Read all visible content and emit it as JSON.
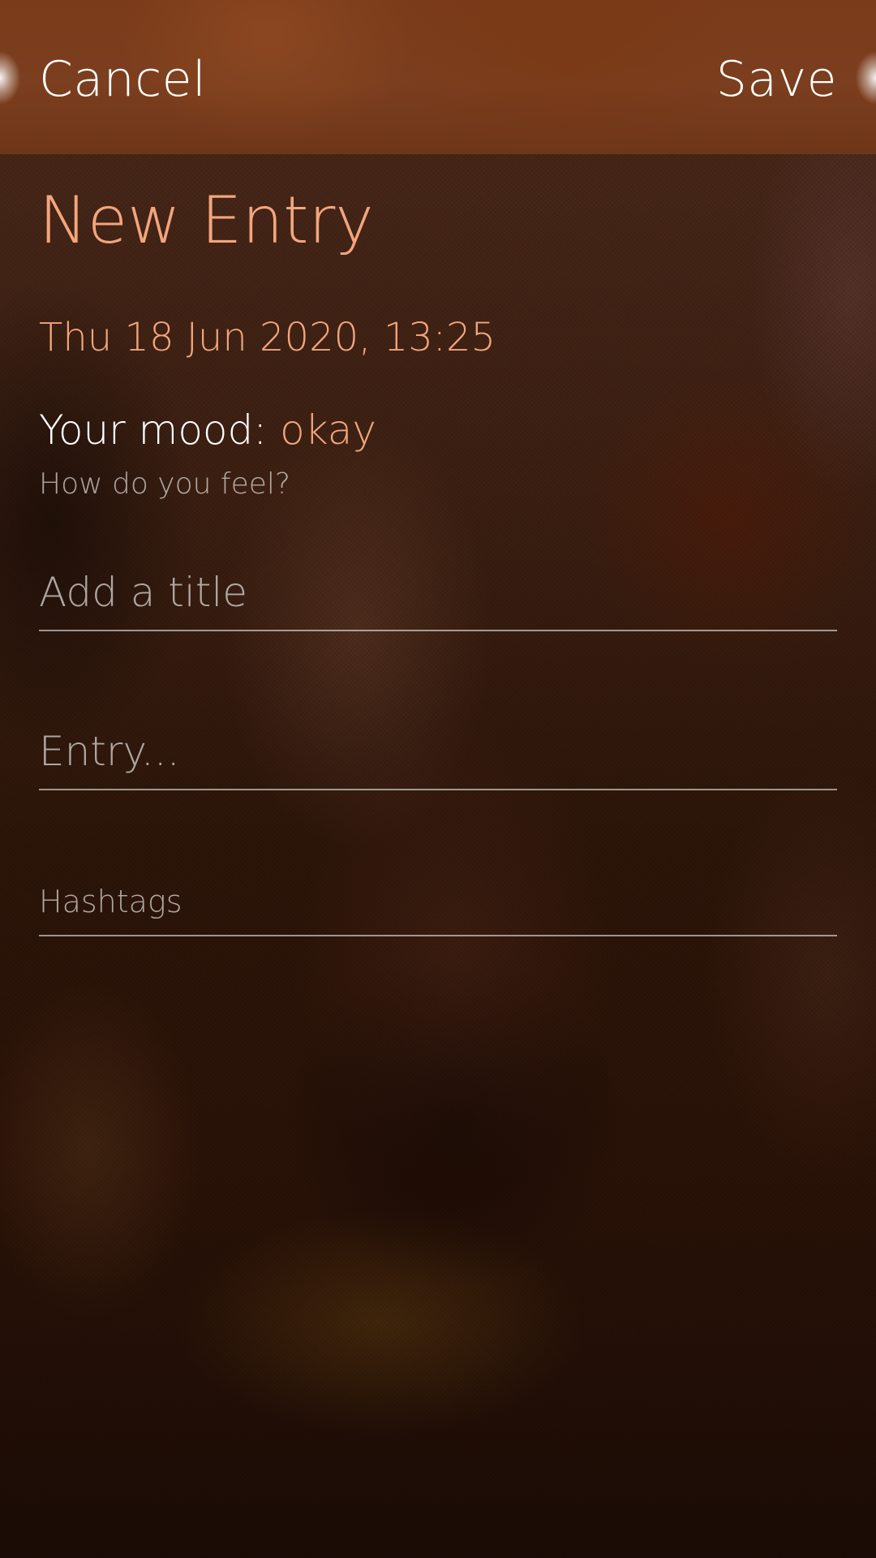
{
  "header": {
    "cancel_label": "Cancel",
    "save_label": "Save"
  },
  "page": {
    "title": "New Entry",
    "datetime": "Thu 18 Jun 2020, 13:25"
  },
  "mood": {
    "label": "Your mood:",
    "value": "okay",
    "hint": "How do you feel?"
  },
  "fields": {
    "title_placeholder": "Add a title",
    "title_value": "",
    "entry_placeholder": "Entry...",
    "entry_value": "",
    "hashtags_placeholder": "Hashtags",
    "hashtags_value": ""
  },
  "colors": {
    "accent": "#f3a57c",
    "header_background": "#7a3b1a",
    "primary_text": "#ffffff"
  }
}
